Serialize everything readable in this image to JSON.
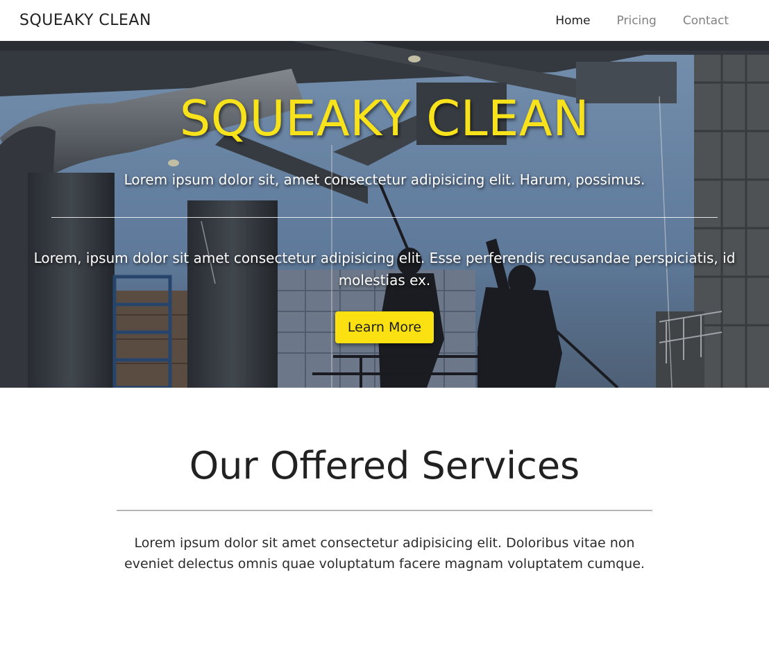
{
  "navbar": {
    "brand": "SQUEAKY CLEAN",
    "links": [
      {
        "label": "Home",
        "active": true
      },
      {
        "label": "Pricing",
        "active": false
      },
      {
        "label": "Contact",
        "active": false
      }
    ]
  },
  "hero": {
    "title": "SQUEAKY CLEAN",
    "subtitle": "Lorem ipsum dolor sit, amet consectetur adipisicing elit. Harum, possimus.",
    "description": "Lorem, ipsum dolor sit amet consectetur adipisicing elit. Esse perferendis recusandae perspiciatis, id molestias ex.",
    "button_label": "Learn More",
    "title_color": "#f7e21c",
    "button_color": "#fbe012"
  },
  "services": {
    "title": "Our Offered Services",
    "text": "Lorem ipsum dolor sit amet consectetur adipisicing elit. Doloribus vitae non eveniet delectus omnis quae voluptatum facere magnam voluptatem cumque."
  }
}
